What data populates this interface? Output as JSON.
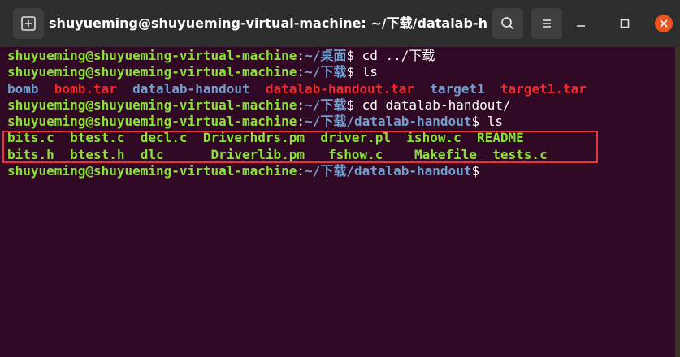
{
  "window": {
    "title": "shuyueming@shuyueming-virtual-machine: ~/下载/datalab-h..."
  },
  "toolbar": {
    "new_tab_icon": "new-tab-icon",
    "search_icon": "search-icon",
    "menu_icon": "hamburger-menu-icon"
  },
  "controls": {
    "minimize_icon": "minimize-icon",
    "maximize_icon": "maximize-icon",
    "close_icon": "close-icon",
    "close_color": "#e95420"
  },
  "colors": {
    "background": "#300a24",
    "user_host": "#8ae234",
    "path": "#729fcf",
    "archive": "#ef2929",
    "highlight": "#e8333a"
  },
  "terminal": {
    "prompt_user": "shuyueming@shuyueming-virtual-machine",
    "lines": [
      {
        "path": "~/桌面",
        "command": "cd ../下载"
      },
      {
        "path": "~/下载",
        "command": "ls"
      },
      {
        "listing": [
          "bomb",
          "bomb.tar",
          "datalab-handout",
          "datalab-handout.tar",
          "target1",
          "target1.tar"
        ]
      },
      {
        "path": "~/下载",
        "command": "cd datalab-handout/"
      },
      {
        "path": "~/下载/datalab-handout",
        "command": "ls"
      },
      {
        "files_row1": [
          "bits.c",
          "btest.c",
          "decl.c",
          "Driverhdrs.pm",
          "driver.pl",
          "ishow.c",
          "README"
        ]
      },
      {
        "files_row2": [
          "bits.h",
          "btest.h",
          "dlc",
          "Driverlib.pm",
          "fshow.c",
          "Makefile",
          "tests.c"
        ]
      },
      {
        "path": "~/下载/datalab-handout",
        "command": ""
      }
    ]
  }
}
